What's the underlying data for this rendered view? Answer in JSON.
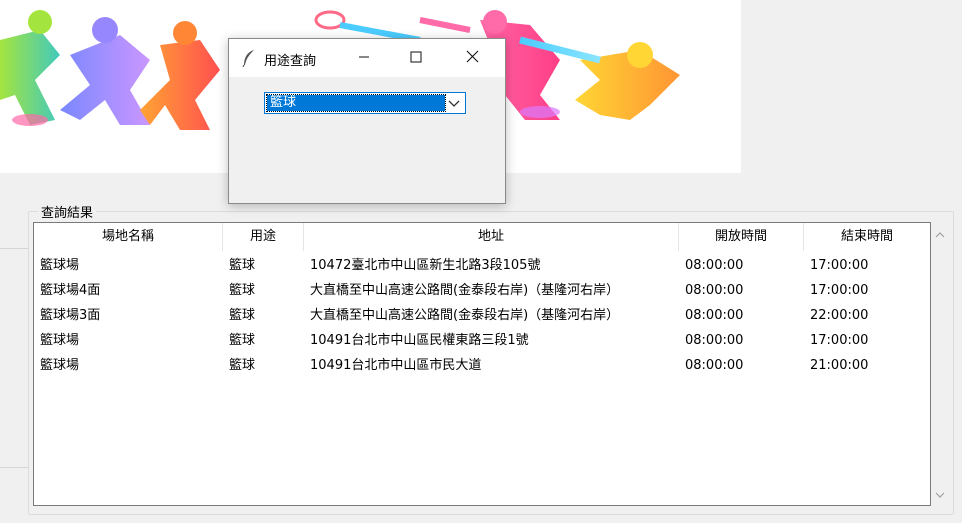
{
  "dialog": {
    "title": "用途查詢",
    "combo_value": "籃球"
  },
  "results": {
    "group_title": "查詢結果",
    "columns": [
      "場地名稱",
      "用途",
      "地址",
      "開放時間",
      "結束時間"
    ],
    "rows": [
      [
        "籃球場",
        "籃球",
        "10472臺北市中山區新生北路3段105號",
        "08:00:00",
        "17:00:00"
      ],
      [
        "籃球場4面",
        "籃球",
        "大直橋至中山高速公路間(金泰段右岸)（基隆河右岸）",
        "08:00:00",
        "17:00:00"
      ],
      [
        "籃球場3面",
        "籃球",
        "大直橋至中山高速公路間(金泰段右岸)（基隆河右岸）",
        "08:00:00",
        "22:00:00"
      ],
      [
        "籃球場",
        "籃球",
        "10491台北市中山區民權東路三段1號",
        "08:00:00",
        "17:00:00"
      ],
      [
        "籃球場",
        "籃球",
        "10491台北市中山區市民大道",
        "08:00:00",
        "21:00:00"
      ]
    ]
  },
  "icons": {
    "app": "feather-icon",
    "minimize": "minimize-icon",
    "maximize": "maximize-icon",
    "close": "close-icon",
    "dropdown": "chevron-down-icon",
    "scroll_up": "scroll-up-icon",
    "scroll_down": "scroll-down-icon"
  },
  "colors": {
    "selection": "#0078d7",
    "window_bg": "#f0f0f0"
  }
}
